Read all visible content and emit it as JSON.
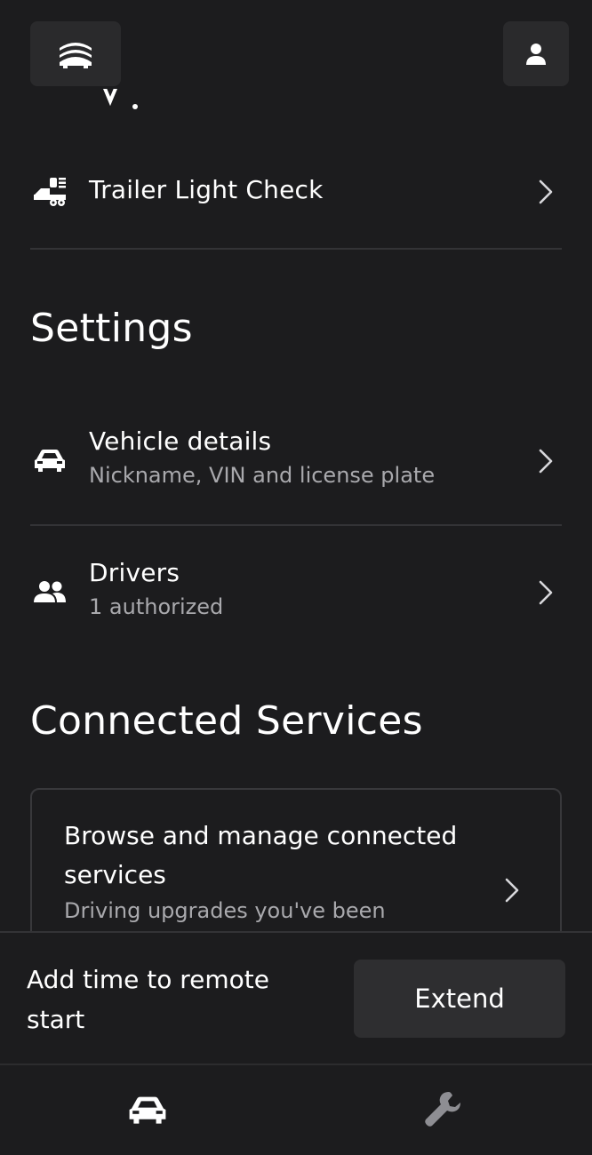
{
  "header": {
    "menu_icon": "vehicle-stack-icon",
    "profile_icon": "person-icon"
  },
  "rows": {
    "trailer": {
      "title": "Trailer Light Check",
      "icon": "trailer-light-icon"
    },
    "vehicle_details": {
      "title": "Vehicle details",
      "subtitle": "Nickname, VIN and license plate",
      "icon": "car-icon"
    },
    "drivers": {
      "title": "Drivers",
      "subtitle": "1 authorized",
      "icon": "people-icon"
    }
  },
  "sections": {
    "settings": "Settings",
    "connected_services": "Connected Services"
  },
  "card": {
    "title": "Browse and manage connected services",
    "subtitle": "Driving upgrades you've been"
  },
  "action_bar": {
    "text": "Add time to remote start",
    "button_label": "Extend"
  },
  "bottom_nav": {
    "items": [
      {
        "icon": "car-icon",
        "active": true
      },
      {
        "icon": "wrench-icon",
        "active": false
      }
    ]
  },
  "colors": {
    "background": "#1c1c1e",
    "surface": "#2a2a2c",
    "text_primary": "#ffffff",
    "text_secondary": "#a9a9ad",
    "divider": "#333336"
  }
}
